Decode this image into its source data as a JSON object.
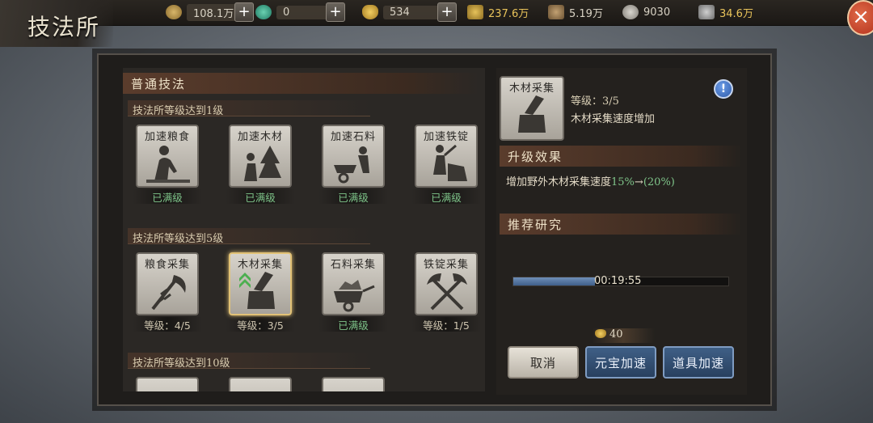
{
  "title": "技法所",
  "close_label": "×",
  "resources": [
    {
      "icon": "copper-coin-icon",
      "value": "108.1万",
      "has_plus": true
    },
    {
      "icon": "jade-icon",
      "value": "0",
      "has_plus": true
    },
    {
      "icon": "gold-ingot-icon",
      "value": "534",
      "has_plus": true
    },
    {
      "icon": "grain-icon",
      "value": "237.6万"
    },
    {
      "icon": "wood-icon",
      "value": "5.19万"
    },
    {
      "icon": "stone-icon",
      "value": "9030"
    },
    {
      "icon": "iron-icon",
      "value": "34.6万"
    }
  ],
  "plus_label": "+",
  "left": {
    "header": "普通技法",
    "sections": [
      {
        "title": "技法所等级达到1级",
        "items": [
          {
            "name": "加速粮食",
            "status": "已满级",
            "max": true
          },
          {
            "name": "加速木材",
            "status": "已满级",
            "max": true
          },
          {
            "name": "加速石料",
            "status": "已满级",
            "max": true
          },
          {
            "name": "加速铁锭",
            "status": "已满级",
            "max": true
          }
        ]
      },
      {
        "title": "技法所等级达到5级",
        "items": [
          {
            "name": "粮食采集",
            "status": "等级：4/5",
            "max": false
          },
          {
            "name": "木材采集",
            "status": "等级：3/5",
            "max": false,
            "selected": true
          },
          {
            "name": "石料采集",
            "status": "已满级",
            "max": true
          },
          {
            "name": "铁锭采集",
            "status": "等级：1/5",
            "max": false
          }
        ]
      },
      {
        "title": "技法所等级达到10级"
      }
    ]
  },
  "right": {
    "skill_name": "木材采集",
    "level_text": "等级：3/5",
    "description": "木材采集速度增加",
    "info_label": "!",
    "effect_header": "升级效果",
    "effect_text": "增加野外木材采集速度",
    "effect_from": "15%",
    "effect_arrow": "→",
    "effect_to": "(20%)",
    "recommend_header": "推荐研究",
    "progress_time": "00:19:55",
    "progress_fraction": 0.38,
    "cost_value": "40",
    "buttons": {
      "cancel": "取消",
      "ingot_speedup": "元宝加速",
      "item_speedup": "道具加速"
    }
  },
  "colors": {
    "max_status": "#7fc58a",
    "effect_highlight": "#7fc58a",
    "accent_blue": "#3f5f86"
  }
}
